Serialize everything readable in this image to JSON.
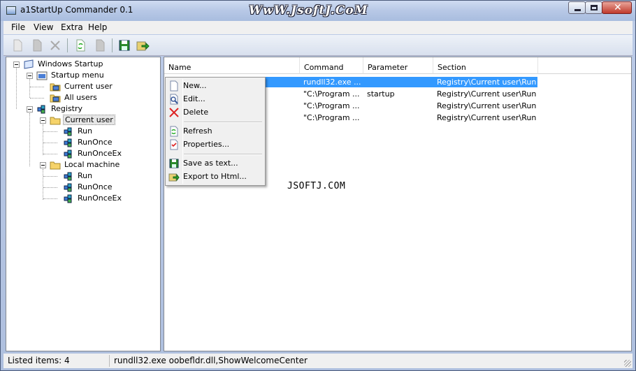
{
  "window": {
    "title": "a1StartUp Commander 0.1",
    "watermark": "WwW.JsoftJ.CoM",
    "close_label": "✕"
  },
  "menubar": {
    "items": [
      "File",
      "View",
      "Extra",
      "Help"
    ]
  },
  "toolbar": {
    "buttons": [
      "new-icon",
      "edit-icon",
      "delete-icon",
      "refresh-icon",
      "properties-icon",
      "save-icon",
      "export-icon"
    ]
  },
  "tree": {
    "root": "Windows Startup",
    "startup_menu": "Startup menu",
    "startup_current_user": "Current user",
    "startup_all_users": "All users",
    "registry": "Registry",
    "reg_current_user": "Current user",
    "cu_run": "Run",
    "cu_runonce": "RunOnce",
    "cu_runonceex": "RunOnceEx",
    "local_machine": "Local machine",
    "lm_run": "Run",
    "lm_runonce": "RunOnce",
    "lm_runonceex": "RunOnceEx"
  },
  "list": {
    "columns": [
      "Name",
      "Command",
      "Parameter",
      "Section"
    ],
    "rows": [
      {
        "command": "rundll32.exe ...",
        "parameter": "",
        "section": "Registry\\Current user\\Run"
      },
      {
        "command": "\"C:\\Program ...",
        "parameter": "startup",
        "section": "Registry\\Current user\\Run"
      },
      {
        "command": "\"C:\\Program ...",
        "parameter": "",
        "section": "Registry\\Current user\\Run"
      },
      {
        "command": "\"C:\\Program ...",
        "parameter": "",
        "section": "Registry\\Current user\\Run"
      }
    ]
  },
  "context_menu": {
    "new": "New...",
    "edit": "Edit...",
    "delete": "Delete",
    "refresh": "Refresh",
    "properties": "Properties...",
    "save_as_text": "Save as text...",
    "export_html": "Export to Html..."
  },
  "center_watermark": "JSOFTJ.COM",
  "status": {
    "listed": "Listed items: 4",
    "selected_command": "rundll32.exe oobefldr.dll,ShowWelcomeCenter"
  },
  "colors": {
    "selection": "#3399ff",
    "menu_bg": "#f0f0f0",
    "frame": "#b7c8e6"
  }
}
